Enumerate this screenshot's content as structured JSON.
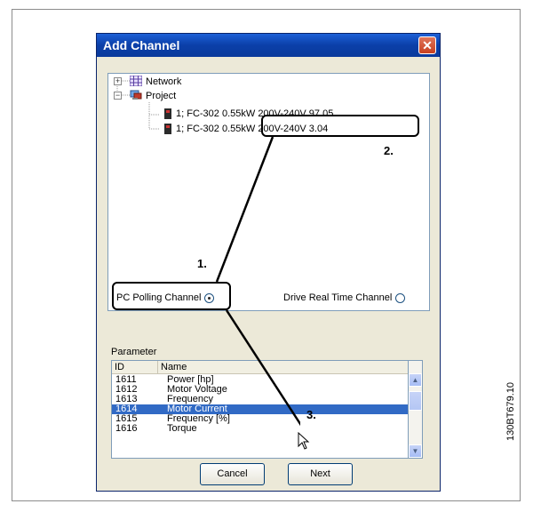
{
  "window": {
    "title": "Add Channel",
    "close_glyph": "✕"
  },
  "tree": {
    "nodes": [
      {
        "label": "Network",
        "expander": "+"
      },
      {
        "label": "Project",
        "expander": "−"
      },
      {
        "label": "1; FC-302 0.55kW 200V-240V 97.05"
      },
      {
        "label": "1; FC-302 0.55kW 200V-240V 3.04"
      }
    ]
  },
  "channel_options": {
    "pc_polling": {
      "label": "PC Polling Channel",
      "selected": true
    },
    "drive_real_time": {
      "label": "Drive Real Time Channel",
      "selected": false
    }
  },
  "parameter": {
    "label": "Parameter",
    "columns": [
      "ID",
      "Name"
    ],
    "rows": [
      {
        "id": "1611",
        "name": "Power [hp]"
      },
      {
        "id": "1612",
        "name": "Motor Voltage"
      },
      {
        "id": "1613",
        "name": "Frequency"
      },
      {
        "id": "1614",
        "name": "Motor Current",
        "selected": true
      },
      {
        "id": "1615",
        "name": "Frequency [%]"
      },
      {
        "id": "1616",
        "name": "Torque"
      }
    ]
  },
  "buttons": {
    "cancel": "Cancel",
    "next": "Next"
  },
  "annotations": {
    "step1": "1.",
    "step2": "2.",
    "step3": "3."
  },
  "figure_ref": "130BT679.10",
  "colors": {
    "titlebar": "#0b3fa8",
    "selection": "#316ac5",
    "dialog_bg": "#ece9d8"
  }
}
